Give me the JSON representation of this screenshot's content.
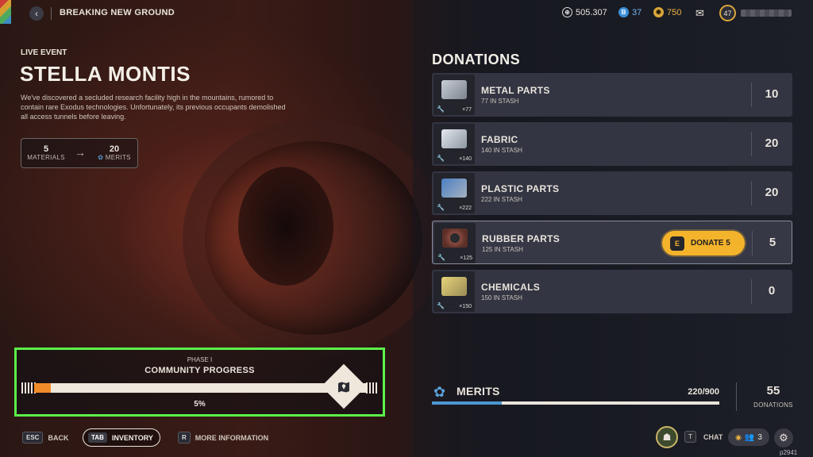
{
  "topbar": {
    "title": "BREAKING NEW GROUND",
    "currency_coins": "505.307",
    "currency_blue": "37",
    "currency_gold": "750",
    "level": "47"
  },
  "event": {
    "tag": "LIVE EVENT",
    "title": "STELLA MONTIS",
    "description": "We've discovered a secluded research facility high in the mountains, rumored to contain rare Exodus technologies. Unfortunately, its previous occupants demolished all access tunnels before leaving.",
    "conversion": {
      "materials_value": "5",
      "materials_label": "MATERIALS",
      "merits_value": "20",
      "merits_label": "MERITS"
    }
  },
  "progress": {
    "phase": "PHASE I",
    "title": "COMMUNITY PROGRESS",
    "percent_label": "5%",
    "fraction": 0.05
  },
  "controls": {
    "back_key": "ESC",
    "back_label": "BACK",
    "inventory_key": "TAB",
    "inventory_label": "INVENTORY",
    "more_key": "R",
    "more_label": "MORE INFORMATION"
  },
  "donations": {
    "title": "DONATIONS",
    "items": [
      {
        "name": "METAL PARTS",
        "stash": "77 IN STASH",
        "count": "×77",
        "value": "10",
        "color": "#9aa3ad"
      },
      {
        "name": "FABRIC",
        "stash": "140 IN STASH",
        "count": "×140",
        "value": "20",
        "color": "#b7c1cc"
      },
      {
        "name": "PLASTIC PARTS",
        "stash": "222 IN STASH",
        "count": "×222",
        "value": "20",
        "color": "#3f6fb0"
      },
      {
        "name": "RUBBER PARTS",
        "stash": "125 IN STASH",
        "count": "×125",
        "value": "5",
        "color": "#8a4a3e"
      },
      {
        "name": "CHEMICALS",
        "stash": "150 IN STASH",
        "count": "×150",
        "value": "0",
        "color": "#c9b45a"
      }
    ],
    "donate_key": "E",
    "donate_label": "DONATE 5"
  },
  "merits": {
    "label": "MERITS",
    "value": "220/900",
    "fraction": 0.244,
    "donations_count": "55",
    "donations_label": "DONATIONS"
  },
  "bottom_right": {
    "chat_key": "T",
    "chat_label": "CHAT",
    "party_count": "3",
    "version": "p2941"
  }
}
